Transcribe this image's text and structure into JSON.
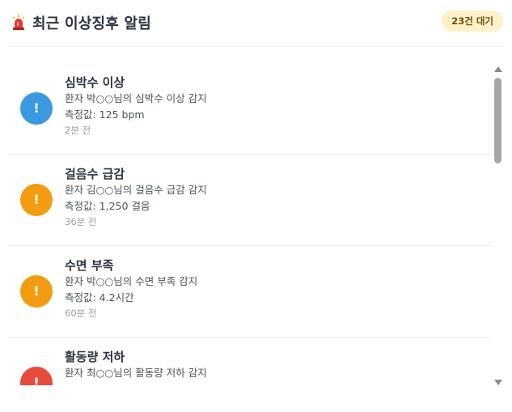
{
  "header": {
    "icon": "siren-icon",
    "title": "최근 이상징후 알림",
    "badge": "23건 대기"
  },
  "alerts": [
    {
      "title": "심박수 이상",
      "description": "환자 박○○님의 심박수 이상 감지",
      "value": "측정값: 125 bpm",
      "time": "2분 전",
      "icon_glyph": "!",
      "color": "#3a9ae0"
    },
    {
      "title": "걸음수 급감",
      "description": "환자 김○○님의 걸음수 급감 감지",
      "value": "측정값: 1,250 걸음",
      "time": "36분 전",
      "icon_glyph": "!",
      "color": "#f39c12"
    },
    {
      "title": "수면 부족",
      "description": "환자 박○○님의 수면 부족 감지",
      "value": "측정값: 4.2시간",
      "time": "60분 전",
      "icon_glyph": "!",
      "color": "#f39c12"
    },
    {
      "title": "활동량 저하",
      "description": "환자 최○○님의 활동량 저하 감지",
      "value": "",
      "time": "",
      "icon_glyph": "!",
      "color": "#e74c3c"
    }
  ]
}
